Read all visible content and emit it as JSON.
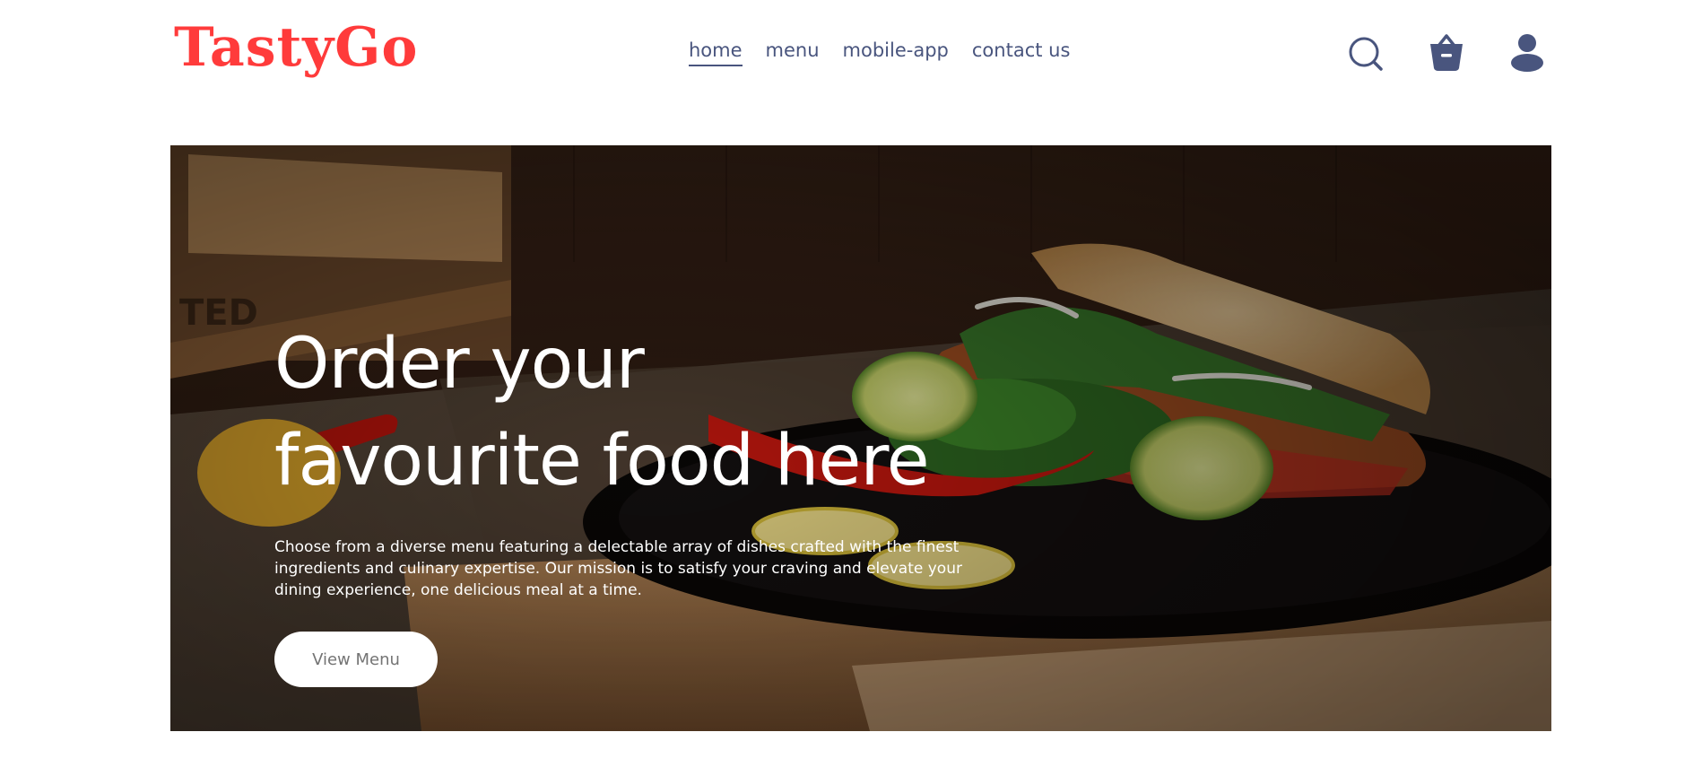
{
  "logo": {
    "text": "TastyGo"
  },
  "nav": {
    "items": [
      {
        "label": "home",
        "active": true
      },
      {
        "label": "menu",
        "active": false
      },
      {
        "label": "mobile-app",
        "active": false
      },
      {
        "label": "contact us",
        "active": false
      }
    ],
    "icons": [
      "search-icon",
      "basket-icon",
      "profile-icon"
    ]
  },
  "hero": {
    "title_line1": "Order your",
    "title_line2": "favourite food here",
    "description": "Choose from a diverse menu featuring a delectable array of dishes crafted with the finest ingredients and culinary expertise. Our mission is to satisfy your craving and elevate your dining experience, one delicious meal at a time.",
    "button_label": "View Menu"
  },
  "colors": {
    "brand": "#ff3b3b",
    "nav_text": "#49557e",
    "button_text": "#747474"
  }
}
